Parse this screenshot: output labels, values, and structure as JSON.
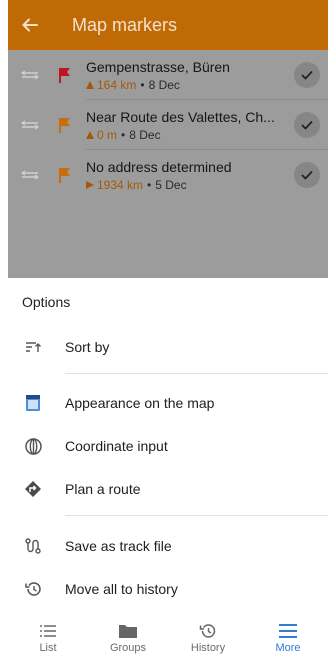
{
  "appbar": {
    "title": "Map markers",
    "back_icon": "arrow-left-icon"
  },
  "markers": [
    {
      "name": "Gempenstrasse, Büren",
      "distance": "164 km",
      "date": "8 Dec",
      "flag_color": "#c0141e",
      "dir_icon": "triangle-up-icon"
    },
    {
      "name": "Near Route des Valettes, Ch...",
      "distance": "0 m",
      "date": "8 Dec",
      "flag_color": "#c96d0a",
      "dir_icon": "triangle-up-icon"
    },
    {
      "name": "No address determined",
      "distance": "1934 km",
      "date": "5 Dec",
      "flag_color": "#c96d0a",
      "dir_icon": "triangle-right-icon"
    }
  ],
  "separator": "•",
  "sheet": {
    "title": "Options",
    "options": [
      {
        "label": "Sort by",
        "icon": "sort-icon"
      },
      {
        "label": "Appearance on the map",
        "icon": "appearance-icon"
      },
      {
        "label": "Coordinate input",
        "icon": "globe-icon"
      },
      {
        "label": "Plan a route",
        "icon": "route-diamond-icon"
      },
      {
        "label": "Save as track file",
        "icon": "track-icon"
      },
      {
        "label": "Move all to history",
        "icon": "history-icon"
      }
    ]
  },
  "nav": {
    "active": "More",
    "tabs": [
      {
        "label": "List",
        "icon": "list-icon"
      },
      {
        "label": "Groups",
        "icon": "folder-icon"
      },
      {
        "label": "History",
        "icon": "history-icon"
      },
      {
        "label": "More",
        "icon": "menu-icon"
      }
    ]
  },
  "colors": {
    "accent": "#c06a06",
    "active": "#2d7cd6"
  }
}
